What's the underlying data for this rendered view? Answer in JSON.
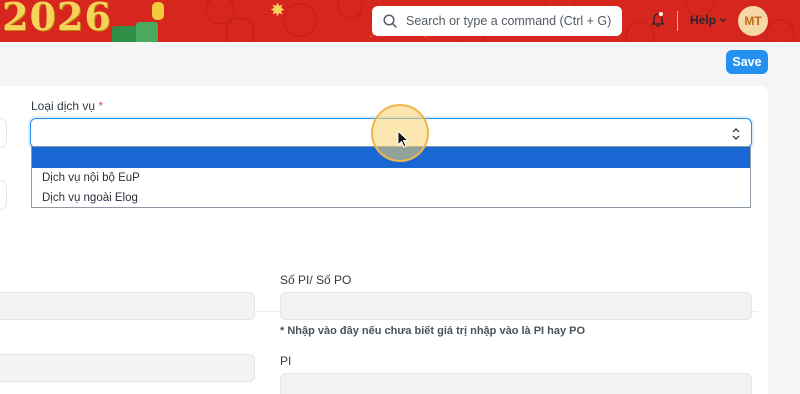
{
  "navbar": {
    "banner_year": "2026",
    "search_placeholder": "Search or type a command (Ctrl + G)",
    "help_label": "Help",
    "avatar_initials": "MT",
    "colors": {
      "bar": "#d7261e",
      "accent": "#f7d35c"
    }
  },
  "toolbar": {
    "save_label": "Save"
  },
  "form": {
    "service_type": {
      "label": "Loại dịch vụ",
      "required_mark": "*",
      "selected_value": "",
      "options": [
        "",
        "Dịch vụ nội bộ EuP",
        "Dịch vụ ngoài Elog"
      ]
    },
    "pi_po": {
      "label": "Số PI/ Số PO",
      "hint": "* Nhập vào đây nếu chưa biết giá trị nhập vào là PI hay PO"
    },
    "pi": {
      "label": "PI"
    }
  },
  "colors": {
    "primary": "#2490ef",
    "dropdown_selected": "#1967d2",
    "required": "#e24c4c"
  }
}
